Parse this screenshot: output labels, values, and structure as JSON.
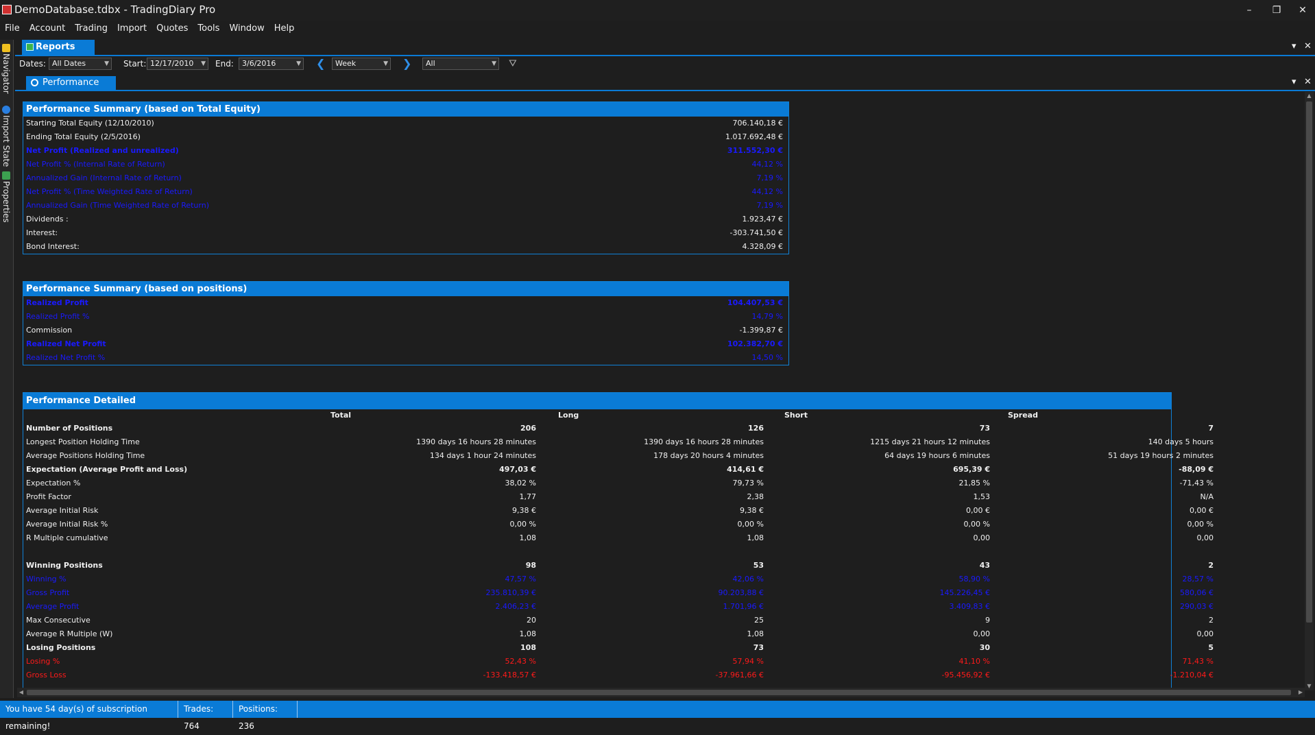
{
  "window": {
    "title": "DemoDatabase.tdbx - TradingDiary Pro",
    "minimize_icon": "minimize-icon",
    "restore_icon": "restore-icon",
    "close_icon": "close-icon",
    "minimize_glyph": "–",
    "restore_glyph": "❐",
    "close_glyph": "✕"
  },
  "menu": [
    "File",
    "Account",
    "Trading",
    "Import",
    "Quotes",
    "Tools",
    "Window",
    "Help"
  ],
  "side_dock": {
    "tabs": [
      {
        "label": "Navigator",
        "icon": "navigator-icon",
        "color": "#f0c020"
      },
      {
        "label": "Import State",
        "icon": "info-icon",
        "color": "#2a7fe0"
      },
      {
        "label": "Properties",
        "icon": "properties-icon",
        "color": "#3ca050"
      }
    ]
  },
  "reports": {
    "tab_label": "Reports",
    "dropdown_glyph": "▾",
    "close_glyph": "✕"
  },
  "toolbar": {
    "dates_label": "Dates:",
    "dates_value": "All Dates",
    "start_label": "Start:",
    "start_value": "12/17/2010",
    "end_label": "End:",
    "end_value": "3/6/2016",
    "prev_glyph": "❮",
    "next_glyph": "❯",
    "period_value": "Week",
    "filter_value": "All",
    "arrow_glyph": "▼",
    "filter_glyph": "⛛"
  },
  "performance": {
    "tab_label": "Performance"
  },
  "summary_equity": {
    "title": "Performance Summary (based on Total Equity)",
    "rows": [
      {
        "label": "Starting Total Equity (12/10/2010)",
        "value": "706.140,18 €",
        "style": "normal"
      },
      {
        "label": "Ending Total Equity (2/5/2016)",
        "value": "1.017.692,48 €",
        "style": "normal"
      },
      {
        "label": "Net Profit (Realized and unrealized)",
        "value": "311.552,30 €",
        "style": "blue-bold"
      },
      {
        "label": "Net Profit % (Internal Rate of Return)",
        "value": "44,12 %",
        "style": "blue"
      },
      {
        "label": "Annualized Gain (Internal Rate of Return)",
        "value": "7,19 %",
        "style": "blue"
      },
      {
        "label": "Net Profit % (Time Weighted Rate of Return)",
        "value": "44,12 %",
        "style": "blue"
      },
      {
        "label": "Annualized Gain (Time Weighted Rate of Return)",
        "value": "7,19 %",
        "style": "blue"
      },
      {
        "label": "Dividends :",
        "value": "1.923,47 €",
        "style": "normal"
      },
      {
        "label": "Interest:",
        "value": "-303.741,50 €",
        "style": "normal"
      },
      {
        "label": "Bond Interest:",
        "value": "4.328,09 €",
        "style": "normal"
      }
    ]
  },
  "summary_positions": {
    "title": "Performance Summary (based on positions)",
    "rows": [
      {
        "label": "Realized Profit",
        "value": "104.407,53 €",
        "style": "blue-bold"
      },
      {
        "label": "Realized Profit %",
        "value": "14,79 %",
        "style": "blue"
      },
      {
        "label": "Commission",
        "value": "-1.399,87 €",
        "style": "normal"
      },
      {
        "label": "Realized Net Profit",
        "value": "102.382,70 €",
        "style": "blue-bold"
      },
      {
        "label": "Realized Net Profit %",
        "value": "14,50 %",
        "style": "blue"
      }
    ]
  },
  "detailed": {
    "title": "Performance Detailed",
    "columns": [
      "Total",
      "Long",
      "Short",
      "Spread"
    ],
    "rows": [
      {
        "label": "Number of Positions",
        "values": [
          "206",
          "126",
          "73",
          "7"
        ],
        "style": "bold"
      },
      {
        "label": "Longest Position Holding Time",
        "values": [
          "1390 days 16 hours 28 minutes",
          "1390 days 16 hours 28 minutes",
          "1215 days 21 hours 12 minutes",
          "140 days 5 hours"
        ],
        "style": "normal"
      },
      {
        "label": "Average Positions Holding Time",
        "values": [
          "134 days 1 hour 24 minutes",
          "178 days 20 hours 4 minutes",
          "64 days 19 hours 6 minutes",
          "51 days 19 hours 2 minutes"
        ],
        "style": "normal"
      },
      {
        "label": "Expectation (Average Profit and Loss)",
        "values": [
          "497,03 €",
          "414,61 €",
          "695,39 €",
          "-88,09 €"
        ],
        "style": "bold"
      },
      {
        "label": "Expectation %",
        "values": [
          "38,02 %",
          "79,73 %",
          "21,85 %",
          "-71,43 %"
        ],
        "style": "normal"
      },
      {
        "label": "Profit Factor",
        "values": [
          "1,77",
          "2,38",
          "1,53",
          "N/A"
        ],
        "style": "normal"
      },
      {
        "label": "Average Initial Risk",
        "values": [
          "9,38 €",
          "9,38 €",
          "0,00 €",
          "0,00 €"
        ],
        "style": "normal"
      },
      {
        "label": "Average Initial Risk %",
        "values": [
          "0,00 %",
          "0,00 %",
          "0,00 %",
          "0,00 %"
        ],
        "style": "normal"
      },
      {
        "label": "R Multiple cumulative",
        "values": [
          "1,08",
          "1,08",
          "0,00",
          "0,00"
        ],
        "style": "normal"
      },
      {
        "label": "",
        "values": [
          "",
          "",
          "",
          ""
        ],
        "style": "spacer"
      },
      {
        "label": "Winning Positions",
        "values": [
          "98",
          "53",
          "43",
          "2"
        ],
        "style": "bold"
      },
      {
        "label": "Winning %",
        "values": [
          "47,57 %",
          "42,06 %",
          "58,90 %",
          "28,57 %"
        ],
        "style": "blue"
      },
      {
        "label": "Gross Profit",
        "values": [
          "235.810,39 €",
          "90.203,88 €",
          "145.226,45 €",
          "580,06 €"
        ],
        "style": "blue"
      },
      {
        "label": "Average Profit",
        "values": [
          "2.406,23 €",
          "1.701,96 €",
          "3.409,83 €",
          "290,03 €"
        ],
        "style": "blue"
      },
      {
        "label": "Max Consecutive",
        "values": [
          "20",
          "25",
          "9",
          "2"
        ],
        "style": "normal"
      },
      {
        "label": "Average R Multiple (W)",
        "values": [
          "1,08",
          "1,08",
          "0,00",
          "0,00"
        ],
        "style": "normal"
      },
      {
        "label": "Losing Positions",
        "values": [
          "108",
          "73",
          "30",
          "5"
        ],
        "style": "bold"
      },
      {
        "label": "Losing %",
        "values": [
          "52,43 %",
          "57,94 %",
          "41,10 %",
          "71,43 %"
        ],
        "style": "red"
      },
      {
        "label": "Gross Loss",
        "values": [
          "-133.418,57 €",
          "-37.961,66 €",
          "-95.456,92 €",
          "-1.210,04 €"
        ],
        "style": "red"
      }
    ]
  },
  "statusbar": {
    "subscription": "You have 54 day(s) of subscription remaining!",
    "trades": "Trades: 764",
    "positions": "Positions: 236"
  }
}
